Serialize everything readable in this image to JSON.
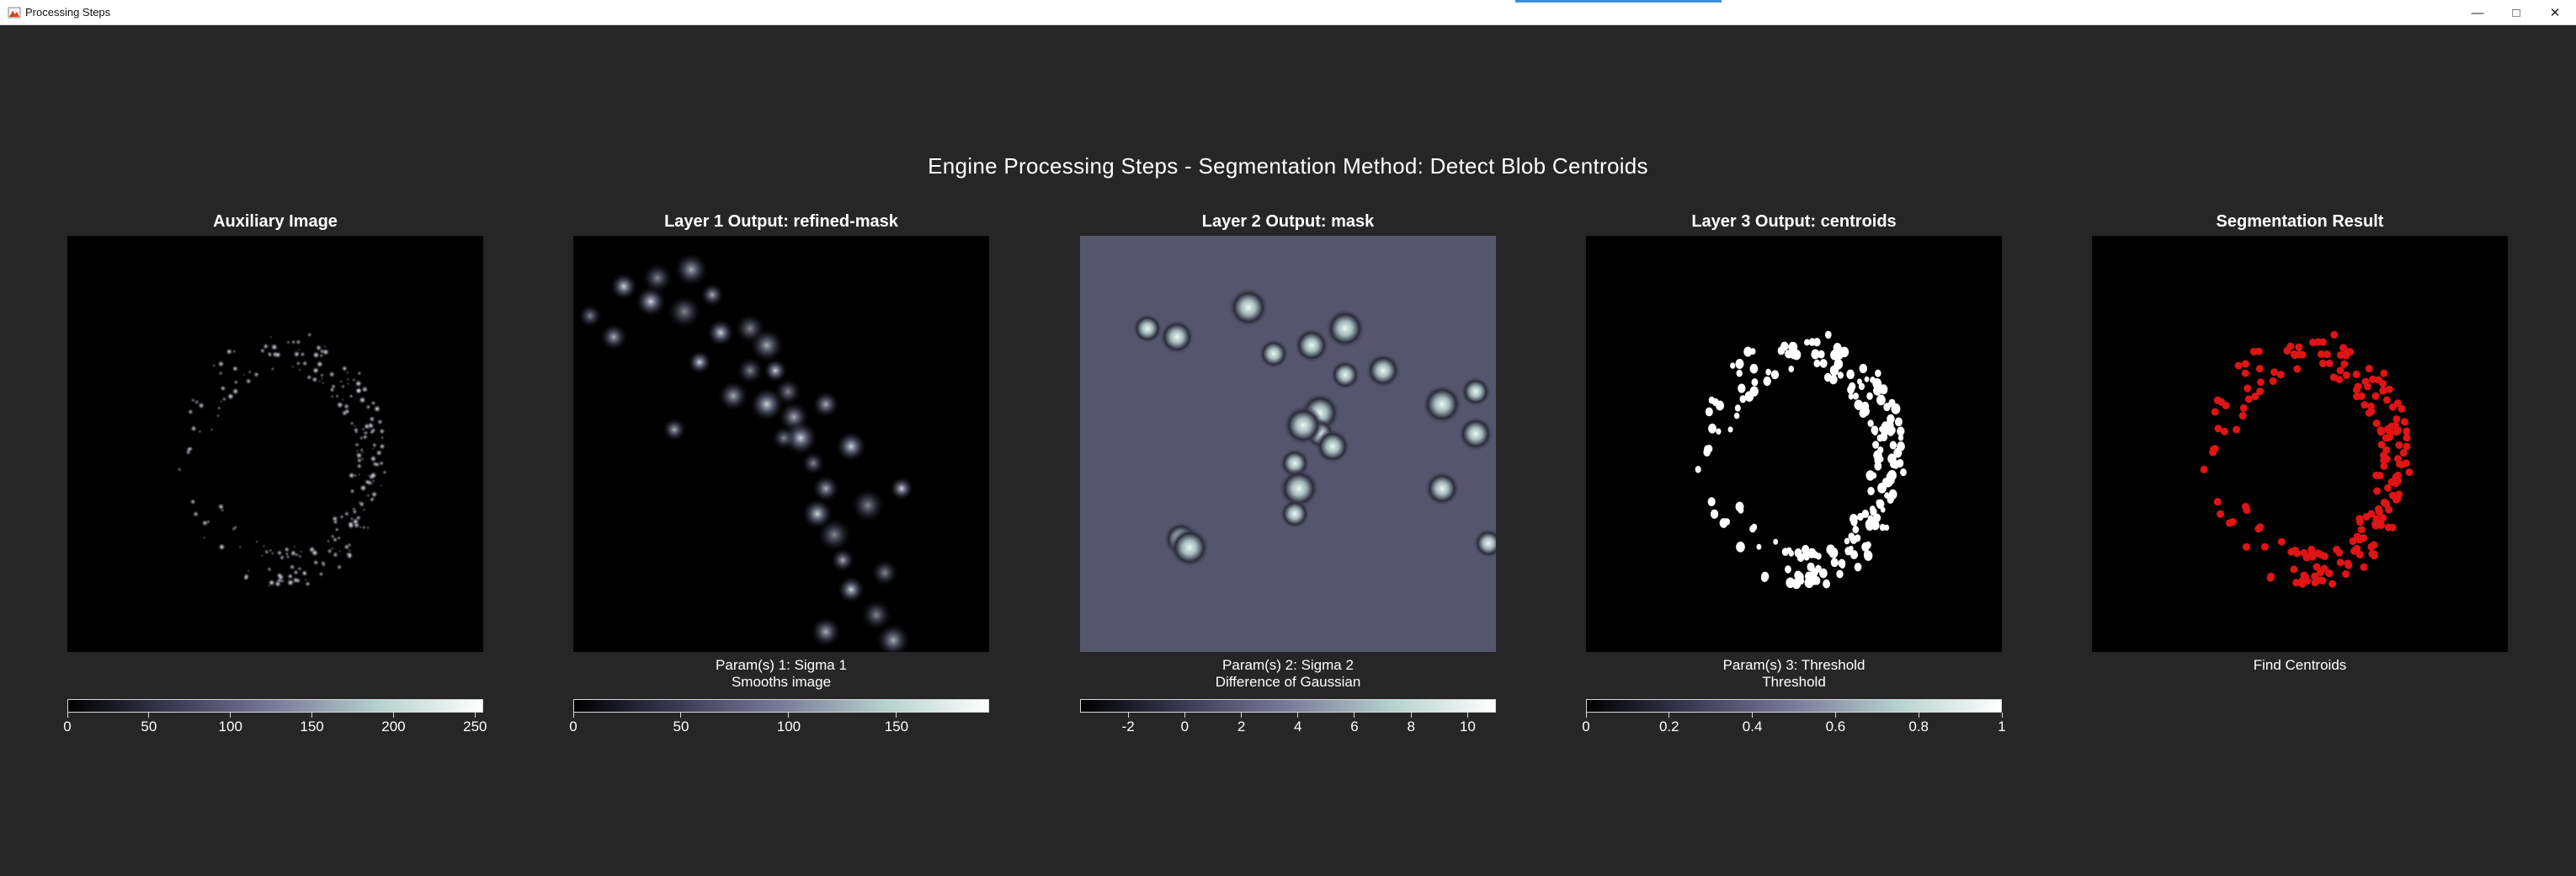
{
  "window": {
    "title": "Processing Steps",
    "controls": [
      "minimize-icon",
      "maximize-icon",
      "close-icon"
    ]
  },
  "figure_title": "Engine Processing Steps - Segmentation Method: Detect Blob Centroids",
  "panels": [
    {
      "title": "Auxiliary Image",
      "captions": [],
      "colorbar": {
        "range": [
          0,
          255
        ],
        "ticks": [
          "0",
          "50",
          "100",
          "150",
          "200",
          "250"
        ],
        "tick_values": [
          0,
          50,
          100,
          150,
          200,
          250
        ]
      }
    },
    {
      "title": "Layer 1 Output: refined-mask",
      "captions": [
        "Param(s) 1: Sigma 1",
        "Smooths image"
      ],
      "colorbar": {
        "range": [
          0,
          193
        ],
        "ticks": [
          "0",
          "50",
          "100",
          "150"
        ],
        "tick_values": [
          0,
          50,
          100,
          150
        ]
      }
    },
    {
      "title": "Layer 2 Output: mask",
      "captions": [
        "Param(s) 2: Sigma 2",
        "Difference of Gaussian"
      ],
      "colorbar": {
        "range": [
          -3.7,
          11
        ],
        "ticks": [
          "-2",
          "0",
          "2",
          "4",
          "6",
          "8",
          "10"
        ],
        "tick_values": [
          -2,
          0,
          2,
          4,
          6,
          8,
          10
        ]
      }
    },
    {
      "title": "Layer 3 Output: centroids",
      "captions": [
        "Param(s) 3: Threshold",
        "Threshold"
      ],
      "colorbar": {
        "range": [
          0,
          1
        ],
        "ticks": [
          "0",
          "0.2",
          "0.4",
          "0.6",
          "0.8",
          "1"
        ],
        "tick_values": [
          0,
          0.2,
          0.4,
          0.6,
          0.8,
          1
        ]
      }
    },
    {
      "title": "Segmentation Result",
      "captions": [
        "Find Centroids"
      ],
      "colorbar": null
    }
  ],
  "colors": {
    "background": "#262626",
    "colormap": [
      "#000000",
      "#3a3a55",
      "#7a7a9a",
      "#b4d2cc",
      "#ffffff"
    ],
    "dog_background": "#55566e",
    "centroid_marker": "#e01414"
  }
}
